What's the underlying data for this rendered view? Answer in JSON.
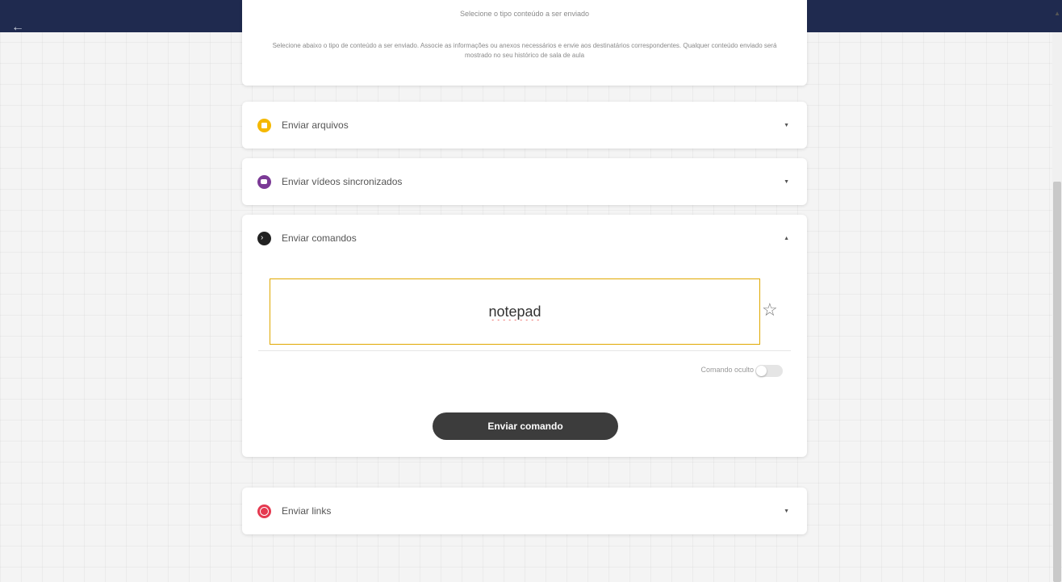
{
  "header": {
    "back_icon": "arrow-left-icon"
  },
  "intro": {
    "title": "Selecione o tipo conteúdo a ser enviado",
    "description": "Selecione abaixo o tipo de conteúdo a ser enviado. Associe as informações ou anexos necessários e envie aos destinatários correspondentes. Qualquer conteúdo enviado será mostrado no seu histórico de sala de aula"
  },
  "sections": {
    "files": {
      "label": "Enviar arquivos",
      "icon": "file-icon",
      "color": "#f5b800",
      "expanded": false
    },
    "videos": {
      "label": "Enviar vídeos sincronizados",
      "icon": "video-icon",
      "color": "#7b3a96",
      "expanded": false
    },
    "commands": {
      "label": "Enviar comandos",
      "icon": "terminal-icon",
      "color": "#222222",
      "expanded": true
    },
    "links": {
      "label": "Enviar links",
      "icon": "globe-icon",
      "color": "#e53950",
      "expanded": false
    }
  },
  "commands": {
    "input_value": "notepad",
    "favorite_icon": "star-icon",
    "hidden_toggle_label": "Comando oculto",
    "hidden_toggle_on": false,
    "send_button": "Enviar comando"
  },
  "colors": {
    "header": "#1f2a4f",
    "input_border": "#e0a800",
    "button": "#3c3c3c"
  }
}
